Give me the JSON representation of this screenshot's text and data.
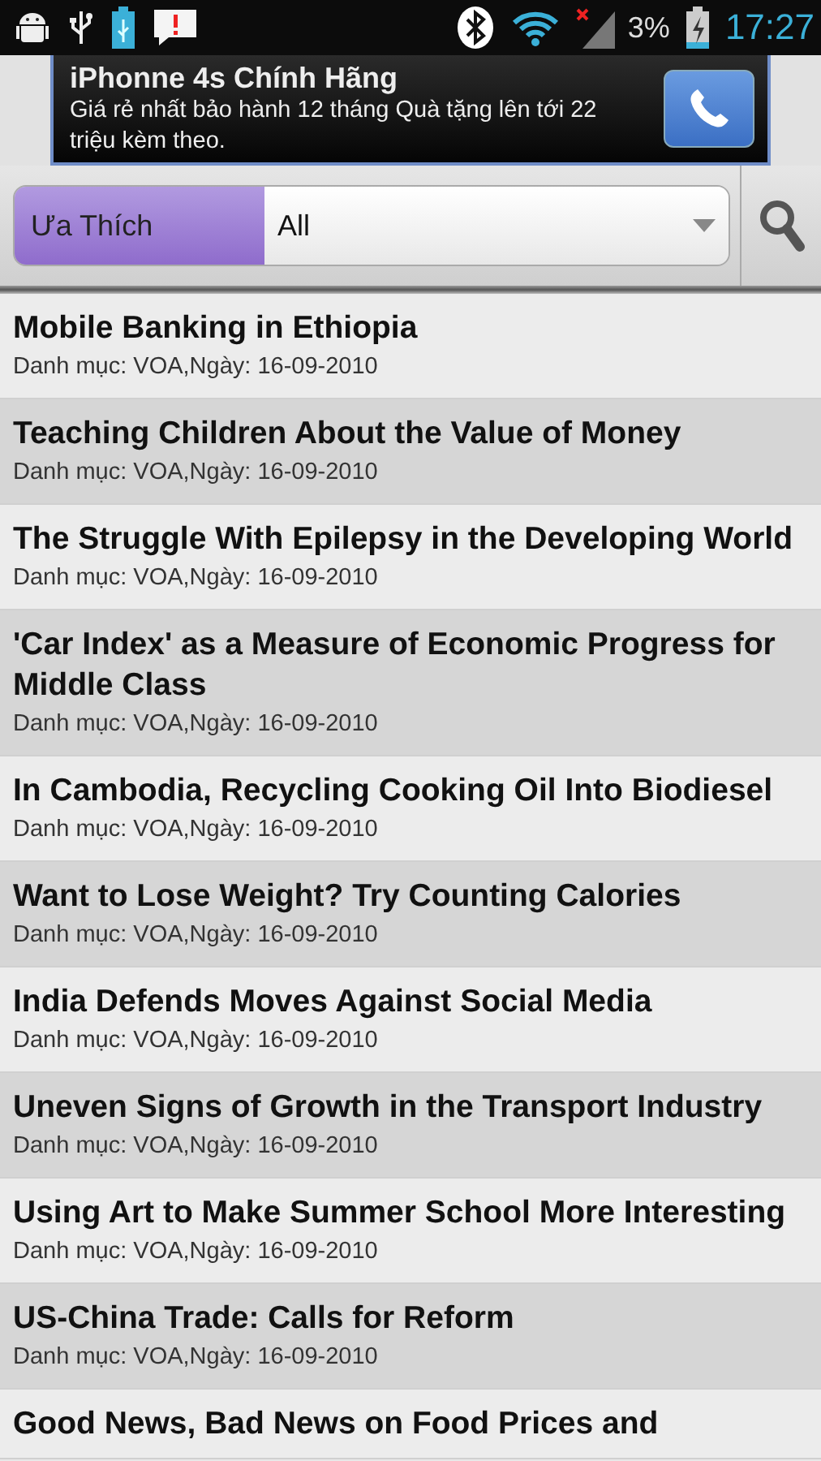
{
  "status_bar": {
    "battery": "3%",
    "time": "17:27"
  },
  "ad": {
    "title": "iPhonne 4s Chính Hãng",
    "text": "Giá rẻ nhất bảo hành 12 tháng Quà tặng lên tới 22 triệu kèm theo."
  },
  "filter": {
    "label": "Ưa Thích",
    "value": "All"
  },
  "articles": [
    {
      "title": "Mobile Banking in Ethiopia",
      "meta": "Danh mục: VOA,Ngày: 16-09-2010"
    },
    {
      "title": "Teaching Children About the Value of Money",
      "meta": "Danh mục: VOA,Ngày: 16-09-2010"
    },
    {
      "title": "The Struggle With Epilepsy in the Developing World",
      "meta": "Danh mục: VOA,Ngày: 16-09-2010"
    },
    {
      "title": "'Car Index' as a Measure of Economic Progress for Middle Class",
      "meta": "Danh mục: VOA,Ngày: 16-09-2010"
    },
    {
      "title": "In Cambodia, Recycling Cooking Oil Into Biodiesel",
      "meta": "Danh mục: VOA,Ngày: 16-09-2010"
    },
    {
      "title": "Want to Lose Weight? Try Counting Calories",
      "meta": "Danh mục: VOA,Ngày: 16-09-2010"
    },
    {
      "title": "India Defends Moves Against Social Media",
      "meta": "Danh mục: VOA,Ngày: 16-09-2010"
    },
    {
      "title": "Uneven Signs of Growth in the Transport Industry",
      "meta": "Danh mục: VOA,Ngày: 16-09-2010"
    },
    {
      "title": "Using Art to Make Summer School More Interesting",
      "meta": "Danh mục: VOA,Ngày: 16-09-2010"
    },
    {
      "title": "US-China Trade: Calls for Reform",
      "meta": "Danh mục: VOA,Ngày: 16-09-2010"
    },
    {
      "title": "Good News, Bad News on Food Prices and"
    }
  ]
}
